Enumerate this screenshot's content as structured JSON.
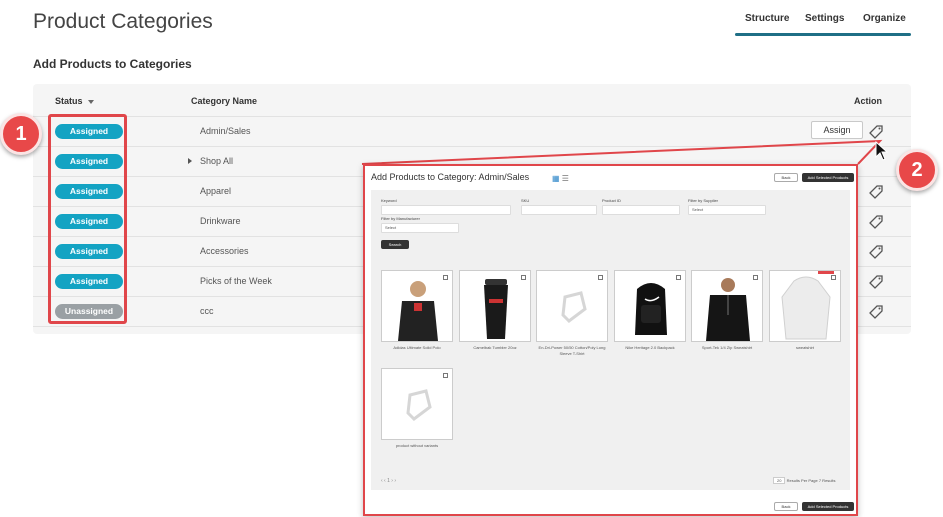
{
  "page": {
    "title": "Product Categories",
    "tabs": [
      "Structure",
      "Settings",
      "Organize"
    ],
    "section_title": "Add Products to Categories"
  },
  "table": {
    "headers": {
      "status": "Status",
      "category": "Category Name",
      "action": "Action"
    },
    "rows": [
      {
        "status": "Assigned",
        "name": "Admin/Sales"
      },
      {
        "status": "Assigned",
        "name": "Shop All"
      },
      {
        "status": "Assigned",
        "name": "Apparel"
      },
      {
        "status": "Assigned",
        "name": "Drinkware"
      },
      {
        "status": "Assigned",
        "name": "Accessories"
      },
      {
        "status": "Assigned",
        "name": "Picks of the Week"
      },
      {
        "status": "Unassigned",
        "name": "ccc"
      }
    ],
    "assign_button": "Assign",
    "sort_icon": "caret-down-icon",
    "expand_icon": "caret-right-icon",
    "action_icon": "tag-icon"
  },
  "callouts": [
    "1",
    "2"
  ],
  "colors": {
    "assigned": "#13a3c3",
    "unassigned": "#9aa0a4",
    "callout": "#e84849",
    "tab_underline": "#1f6f86"
  },
  "modal": {
    "title": "Add Products to Category: Admin/Sales",
    "back_label": "Back",
    "add_label": "Add Selected Products",
    "filters": {
      "keyword_label": "Keyword",
      "sku_label": "SKU",
      "product_id_label": "Product ID",
      "supplier_label": "Filter by Supplier",
      "supplier_value": "Select",
      "manufacturer_label": "Filter by Manufacturer",
      "manufacturer_value": "Select",
      "search_label": "Search"
    },
    "products": [
      "Adidas Ultimate Solid Polo",
      "Camelbak Tumbler 20oz",
      "En-Dri-Power 50/50 Cotton/Poly Long Sleeve T-Shirt",
      "Nike Heritage 2.0 Backpack",
      "Sport-Tek 1/4 Zip Sweatshirt",
      "sweatshirt",
      "product without variants"
    ],
    "pager": "‹ ‹ 1 › ›",
    "per_page": "20",
    "per_page_label": "Results Per Page",
    "results": "7 Results"
  }
}
